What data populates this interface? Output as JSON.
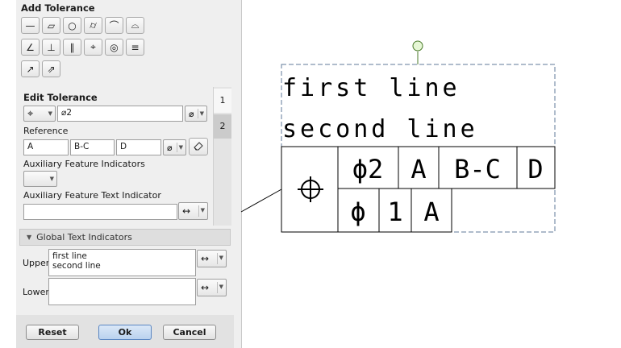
{
  "add_tolerance": {
    "title": "Add Tolerance",
    "tools": [
      {
        "name": "straightness-icon",
        "glyph": "—"
      },
      {
        "name": "flatness-icon",
        "glyph": "▱"
      },
      {
        "name": "circularity-icon",
        "glyph": "○"
      },
      {
        "name": "cylindricity-icon",
        "glyph": "⌭"
      },
      {
        "name": "line-profile-icon",
        "glyph": "⌒"
      },
      {
        "name": "surface-profile-icon",
        "glyph": "⌓"
      },
      {
        "name": "angularity-icon",
        "glyph": "∠"
      },
      {
        "name": "perpendicularity-icon",
        "glyph": "⊥"
      },
      {
        "name": "parallelism-icon",
        "glyph": "∥"
      },
      {
        "name": "position-icon",
        "glyph": "⌖"
      },
      {
        "name": "concentricity-icon",
        "glyph": "◎"
      },
      {
        "name": "symmetry-icon",
        "glyph": "≡"
      },
      {
        "name": "circular-runout-icon",
        "glyph": "↗"
      },
      {
        "name": "total-runout-icon",
        "glyph": "⇗"
      }
    ]
  },
  "edit_tolerance": {
    "title": "Edit Tolerance",
    "symbol_glyph": "⌖",
    "value": "⌀2",
    "diameter_glyph": "⌀",
    "reference_label": "Reference",
    "references": [
      "A",
      "B-C",
      "D"
    ],
    "aux_feature_label": "Auxiliary Feature Indicators",
    "aux_text_label": "Auxiliary Feature Text Indicator",
    "aux_text_value": "",
    "tabs": [
      "1",
      "2"
    ]
  },
  "global_text": {
    "title": "Global Text Indicators",
    "upper_label": "Upper",
    "upper_lines": [
      "first line",
      "second line"
    ],
    "lower_label": "Lower",
    "lower_value": ""
  },
  "buttons": {
    "reset": "Reset",
    "ok": "Ok",
    "cancel": "Cancel"
  },
  "drawing": {
    "upper_text": [
      "first line",
      "second line"
    ],
    "symbol_glyph": "⌖",
    "row1": [
      "ϕ2",
      "A",
      "B-C",
      "D"
    ],
    "row2": [
      "ϕ",
      "1",
      "A"
    ]
  }
}
